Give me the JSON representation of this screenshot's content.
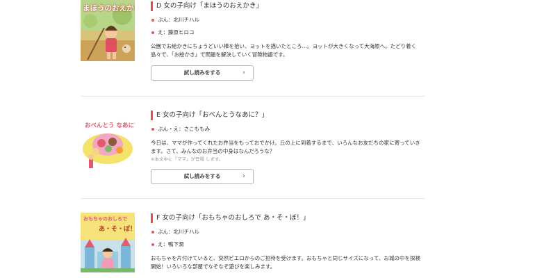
{
  "books": [
    {
      "title": "D 女の子向け「まほうのおえかき」",
      "author": "ぶん：北川チハル",
      "illustrator": "え：藤原ヒロコ",
      "description": "公園でお絵かきにちょうどいい棒を拾い、ヨットを描いたところ…。ヨットが大きくなって大海原へ。たどり着く島々で、「お絵かき」で問題を解決していく冒険物語です。",
      "button": "試し読みをする",
      "cover_title": "まほうのおえかき"
    },
    {
      "title": "E 女の子向け「おべんとうなあに？」",
      "author": "ぶん・え：さこももみ",
      "description": "今日は、ママが作ってくれたお弁当をもっておでかけ。丘の上に到着するまで、いろんなお友だちの家に寄っていきます。さて、みんなのお弁当の中身はなんだろうな？",
      "note": "※本文中に「ママ」が登場 します。",
      "button": "試し読みをする",
      "cover_title": "おべんとう なあに？"
    },
    {
      "title": "F 女の子向け「おもちゃのおしろで あ・そ・ぼ！」",
      "author": "ぶん：北川チハル",
      "illustrator": "え：鴨下潤",
      "description": "おもちゃを片付けていると、突然ピエロからのご招待を受けます。おもちゃと同じサイズになって、お城の中を探検開始！いろいろな部屋でなぞなぞ遊びを楽しみます。",
      "cover_title_1": "おもちゃのおしろで",
      "cover_title_2": "あ・そ・ぼ！"
    }
  ],
  "chevron": "›"
}
